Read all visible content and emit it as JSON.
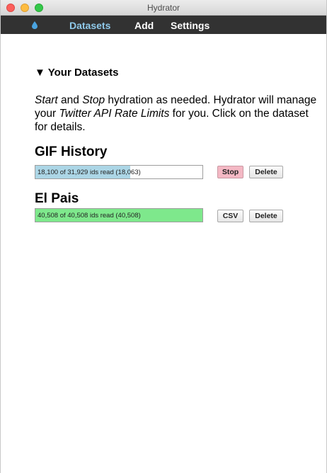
{
  "window": {
    "title": "Hydrator"
  },
  "nav": {
    "icon": "water-drop-icon",
    "items": [
      {
        "label": "Datasets",
        "active": true
      },
      {
        "label": "Add",
        "active": false
      },
      {
        "label": "Settings",
        "active": false
      }
    ]
  },
  "datasets_section": {
    "heading": "▼ Your Datasets",
    "intro": {
      "start": "Start",
      "and": " and ",
      "stop": "Stop",
      "middle": " hydration as needed. Hydrator will manage your ",
      "limits": "Twitter API Rate Limits",
      "end": " for you. Click on the dataset for details."
    }
  },
  "datasets": [
    {
      "title": "GIF History",
      "progress_text": "18,100 of 31,929 ids read (18,063)",
      "progress_fraction": 0.567,
      "fill_color": "#acd6e6",
      "primary_button": "Stop",
      "primary_button_color": "#f4b8c4",
      "delete_button": "Delete"
    },
    {
      "title": "El Pais",
      "progress_text": "40,508 of 40,508 ids read (40,508)",
      "progress_fraction": 1.0,
      "fill_color": "#7ee88c",
      "primary_button": "CSV",
      "delete_button": "Delete"
    }
  ],
  "colors": {
    "navbar_bg": "#323232",
    "nav_active": "#8fc9ea",
    "drop_icon": "#4aa3df"
  }
}
